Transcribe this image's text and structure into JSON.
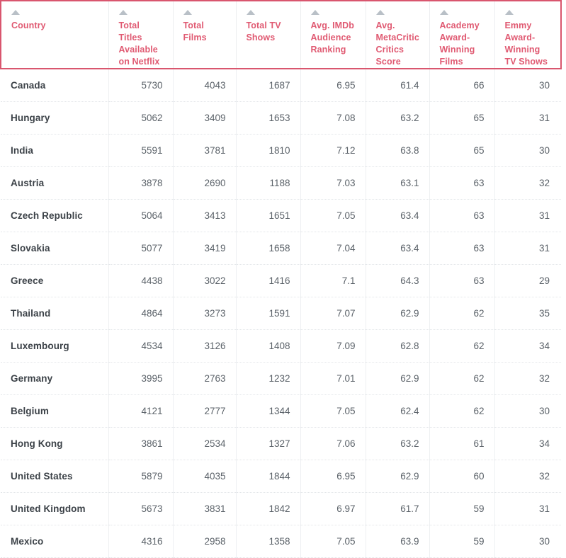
{
  "table": {
    "sort_icon": "sort-ascending-triangle-icon",
    "accent_color": "#e05a72",
    "header_border_color": "#d9566e",
    "columns": [
      {
        "key": "country",
        "label": "Country",
        "align": "left"
      },
      {
        "key": "total_titles",
        "label": "Total Titles Available on Netflix",
        "align": "right"
      },
      {
        "key": "total_films",
        "label": "Total Films",
        "align": "right"
      },
      {
        "key": "total_tv",
        "label": "Total TV Shows",
        "align": "right"
      },
      {
        "key": "imdb",
        "label": "Avg. IMDb Audience Ranking",
        "align": "right"
      },
      {
        "key": "metacritic",
        "label": "Avg. MetaCritic Critics Score",
        "align": "right"
      },
      {
        "key": "oscars",
        "label": "Academy Award-Winning Films",
        "align": "right"
      },
      {
        "key": "emmys",
        "label": "Emmy Award-Winning TV Shows",
        "align": "right"
      }
    ],
    "rows": [
      {
        "country": "Canada",
        "total_titles": "5730",
        "total_films": "4043",
        "total_tv": "1687",
        "imdb": "6.95",
        "metacritic": "61.4",
        "oscars": "66",
        "emmys": "30"
      },
      {
        "country": "Hungary",
        "total_titles": "5062",
        "total_films": "3409",
        "total_tv": "1653",
        "imdb": "7.08",
        "metacritic": "63.2",
        "oscars": "65",
        "emmys": "31"
      },
      {
        "country": "India",
        "total_titles": "5591",
        "total_films": "3781",
        "total_tv": "1810",
        "imdb": "7.12",
        "metacritic": "63.8",
        "oscars": "65",
        "emmys": "30"
      },
      {
        "country": "Austria",
        "total_titles": "3878",
        "total_films": "2690",
        "total_tv": "1188",
        "imdb": "7.03",
        "metacritic": "63.1",
        "oscars": "63",
        "emmys": "32"
      },
      {
        "country": "Czech Republic",
        "total_titles": "5064",
        "total_films": "3413",
        "total_tv": "1651",
        "imdb": "7.05",
        "metacritic": "63.4",
        "oscars": "63",
        "emmys": "31"
      },
      {
        "country": "Slovakia",
        "total_titles": "5077",
        "total_films": "3419",
        "total_tv": "1658",
        "imdb": "7.04",
        "metacritic": "63.4",
        "oscars": "63",
        "emmys": "31"
      },
      {
        "country": "Greece",
        "total_titles": "4438",
        "total_films": "3022",
        "total_tv": "1416",
        "imdb": "7.1",
        "metacritic": "64.3",
        "oscars": "63",
        "emmys": "29"
      },
      {
        "country": "Thailand",
        "total_titles": "4864",
        "total_films": "3273",
        "total_tv": "1591",
        "imdb": "7.07",
        "metacritic": "62.9",
        "oscars": "62",
        "emmys": "35"
      },
      {
        "country": "Luxembourg",
        "total_titles": "4534",
        "total_films": "3126",
        "total_tv": "1408",
        "imdb": "7.09",
        "metacritic": "62.8",
        "oscars": "62",
        "emmys": "34"
      },
      {
        "country": "Germany",
        "total_titles": "3995",
        "total_films": "2763",
        "total_tv": "1232",
        "imdb": "7.01",
        "metacritic": "62.9",
        "oscars": "62",
        "emmys": "32"
      },
      {
        "country": "Belgium",
        "total_titles": "4121",
        "total_films": "2777",
        "total_tv": "1344",
        "imdb": "7.05",
        "metacritic": "62.4",
        "oscars": "62",
        "emmys": "30"
      },
      {
        "country": "Hong Kong",
        "total_titles": "3861",
        "total_films": "2534",
        "total_tv": "1327",
        "imdb": "7.06",
        "metacritic": "63.2",
        "oscars": "61",
        "emmys": "34"
      },
      {
        "country": "United States",
        "total_titles": "5879",
        "total_films": "4035",
        "total_tv": "1844",
        "imdb": "6.95",
        "metacritic": "62.9",
        "oscars": "60",
        "emmys": "32"
      },
      {
        "country": "United Kingdom",
        "total_titles": "5673",
        "total_films": "3831",
        "total_tv": "1842",
        "imdb": "6.97",
        "metacritic": "61.7",
        "oscars": "59",
        "emmys": "31"
      },
      {
        "country": "Mexico",
        "total_titles": "4316",
        "total_films": "2958",
        "total_tv": "1358",
        "imdb": "7.05",
        "metacritic": "63.9",
        "oscars": "59",
        "emmys": "30"
      }
    ]
  }
}
